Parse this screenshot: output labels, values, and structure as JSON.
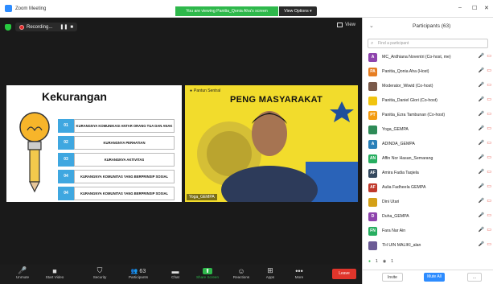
{
  "window": {
    "app_title": "Zoom Meeting",
    "banner": "You are viewing Panitia_Qonia Aha's screen",
    "view_options": "View Options ▾",
    "min": "–",
    "max": "☐",
    "close": "✕"
  },
  "meeting": {
    "recording_label": "Recording...",
    "view_label": "View",
    "slide": {
      "title": "Kekurangan",
      "items": [
        {
          "num": "01",
          "text": "KURANGNYA KOMUNIKASI ANTAR ORANG TUA DAN ANAK"
        },
        {
          "num": "02",
          "text": "KURANGNYA PERHATIAN"
        },
        {
          "num": "03",
          "text": "KURANGNYA AKTIVITAS"
        },
        {
          "num": "04",
          "text": "KURANGNYA KOMUNITAS YANG BERPRINSIP SOSIAL"
        },
        {
          "num": "04",
          "text": "KURANGNYA KOMUNITAS YANG BERPRINSIP SOSIAL"
        }
      ]
    },
    "camera": {
      "background_text": "PENG      MASYARAKAT",
      "name": "Yoga_GEMPA",
      "top_label": "Pantun Sentral"
    }
  },
  "toolbar": {
    "items": [
      {
        "label": "Unmute",
        "icon": "mic-off-icon",
        "glyph": "🎤"
      },
      {
        "label": "Start Video",
        "icon": "video-icon",
        "glyph": "■"
      },
      {
        "label": "Security",
        "icon": "shield-icon",
        "glyph": "⛉"
      },
      {
        "label": "Participants",
        "icon": "participants-icon",
        "glyph": "👥 63"
      },
      {
        "label": "Chat",
        "icon": "chat-icon",
        "glyph": "▬"
      },
      {
        "label": "Share Screen",
        "icon": "share-icon",
        "glyph": "⬆"
      },
      {
        "label": "Reactions",
        "icon": "reactions-icon",
        "glyph": "☺"
      },
      {
        "label": "Apps",
        "icon": "apps-icon",
        "glyph": "⊞"
      },
      {
        "label": "More",
        "icon": "more-icon",
        "glyph": "•••"
      }
    ],
    "leave_label": "Leave"
  },
  "participants": {
    "title": "Participants (63)",
    "search_placeholder": "Find a participant",
    "list": [
      {
        "initials": "A",
        "color": "#8e44ad",
        "name": "MC_Ardhiana Noventri (Co-host, me)",
        "icon": "avatar-initial"
      },
      {
        "initials": "PA",
        "color": "#e67e22",
        "name": "Panitia_Qonia Aha (Host)",
        "icon": "avatar-initial"
      },
      {
        "initials": "",
        "color": "#7a5a4a",
        "name": "Moderator_Wiwid (Co-host)",
        "icon": "avatar-photo"
      },
      {
        "initials": "",
        "color": "#f1c40f",
        "name": "Panitia_Daniel Glori (Co-host)",
        "icon": "avatar-photo"
      },
      {
        "initials": "PT",
        "color": "#f39c12",
        "name": "Panitia_Ezra Tambunan (Co-host)",
        "icon": "avatar-initial"
      },
      {
        "initials": "",
        "color": "#2e8b57",
        "name": "Yoga_GEMPA",
        "icon": "avatar-photo"
      },
      {
        "initials": "A",
        "color": "#2980b9",
        "name": "ADINDA_GEMPA",
        "icon": "avatar-initial"
      },
      {
        "initials": "AN",
        "color": "#27ae60",
        "name": "Affin Nor Hasan_Semarang",
        "icon": "avatar-initial"
      },
      {
        "initials": "AF",
        "color": "#34495e",
        "name": "Amira Fadia Taqiela",
        "icon": "avatar-initial"
      },
      {
        "initials": "AF",
        "color": "#c0392b",
        "name": "Aulia Fadheela GEMPA",
        "icon": "avatar-initial"
      },
      {
        "initials": "",
        "color": "#d4a017",
        "name": "Dini Utari",
        "icon": "avatar-photo"
      },
      {
        "initials": "D",
        "color": "#8e44ad",
        "name": "Duha_GEMPA",
        "icon": "avatar-initial"
      },
      {
        "initials": "FN",
        "color": "#27ae60",
        "name": "Fara Nar Ain",
        "icon": "avatar-initial"
      },
      {
        "initials": "",
        "color": "#6b5b95",
        "name": "TH UIN MALIKI_alan",
        "icon": "avatar-photo"
      }
    ],
    "status_counts": [
      "1",
      "1"
    ],
    "invite_label": "Invite",
    "mute_all_label": "Mute All",
    "more_label": "..."
  }
}
